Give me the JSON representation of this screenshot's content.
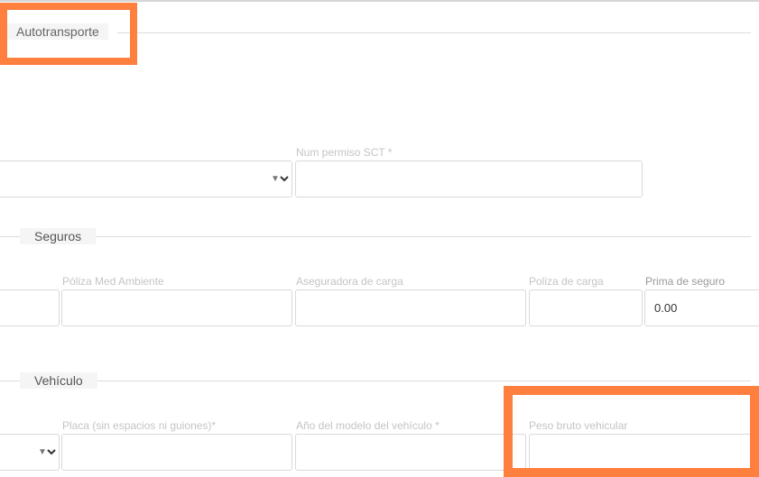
{
  "sections": {
    "autotransporte": "Autotransporte",
    "seguros": "Seguros",
    "vehiculo": "Vehículo"
  },
  "autotransporte": {
    "num_permiso_label": "Num permiso SCT *",
    "num_permiso_value": ""
  },
  "seguros": {
    "poliza_med_label": "Póliza Med Ambiente",
    "aseguradora_label": "Aseguradora de carga",
    "poliza_carga_label": "Poliza de carga",
    "prima_label": "Prima de seguro",
    "prima_value": "0.00"
  },
  "vehiculo": {
    "placa_label": "Placa (sin espacios ni guiones)*",
    "anio_label": "Año del modelo del vehículo *",
    "peso_label": "Peso bruto vehicular"
  },
  "icons": {
    "caret": "▼"
  },
  "colors": {
    "highlight": "#ff7f3f"
  }
}
